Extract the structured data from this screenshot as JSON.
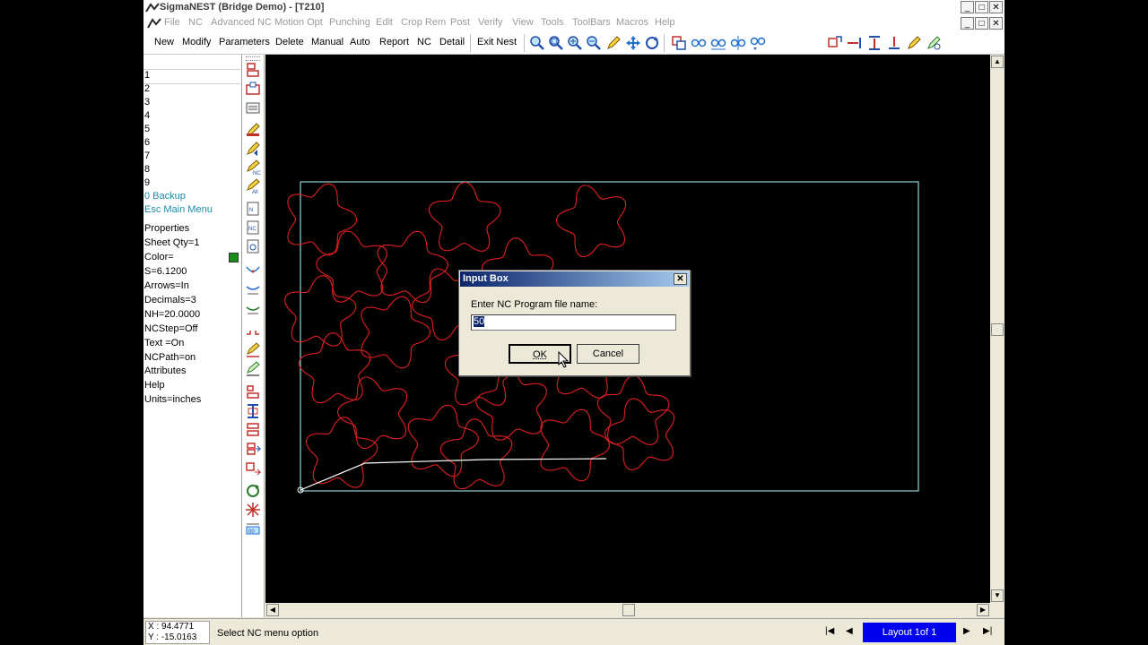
{
  "window": {
    "title": "SigmaNEST   (Bridge Demo) - [T210]",
    "min": "_",
    "max": "□",
    "close": "✕"
  },
  "menus": [
    "File",
    "NC",
    "Advanced NC",
    "Motion Opt",
    "Punching",
    "Edit",
    "Crop Rem",
    "Post",
    "Verify",
    "View",
    "Tools",
    "ToolBars",
    "Macros",
    "Help"
  ],
  "toolbar": {
    "new": "New",
    "modify": "Modify",
    "parameters": "Parameters",
    "delete": "Delete",
    "manual": "Manual",
    "auto": "Auto",
    "report": "Report",
    "nc": "NC",
    "detail": "Detail",
    "exit_nest": "Exit Nest"
  },
  "left_panel": {
    "numbers": [
      "1",
      "2",
      "3",
      "4",
      "5",
      "6",
      "7",
      "8",
      "9"
    ],
    "backup": "0 Backup",
    "main_menu": "Esc Main Menu",
    "properties": [
      "Properties",
      "Sheet Qty=1",
      "Color=",
      "S=6.1200",
      "Arrows=In",
      "Decimals=3",
      "NH=20.0000",
      "NCStep=Off",
      "Text  =On",
      "NCPath=on",
      "Attributes",
      "Help",
      "Units=inches"
    ],
    "color_swatch": "#1a8c1a"
  },
  "dialog": {
    "title": "Input Box",
    "close": "✕",
    "prompt": "Enter NC Program file name:",
    "value": "50",
    "ok": "OK",
    "cancel": "Cancel"
  },
  "status": {
    "x": "X : 94.4771",
    "y": "Y : -15.0163",
    "message": "Select NC menu option",
    "layout_tab": "Layout 1of 1"
  },
  "colors": {
    "sheet_border": "#8fd6d6",
    "part_outline": "#e02020",
    "tool_path": "#ffffff"
  }
}
